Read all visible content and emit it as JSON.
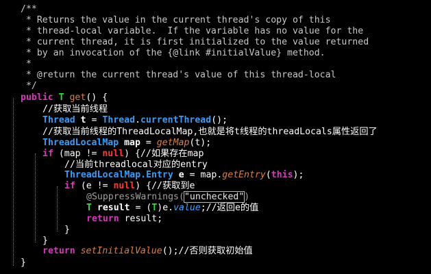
{
  "lines": [
    {
      "indent": 1,
      "tokens": [
        {
          "t": "/**",
          "k": "c"
        }
      ]
    },
    {
      "indent": 1,
      "tokens": [
        {
          "t": " * Returns the value in the current thread's copy of this",
          "k": "c"
        }
      ]
    },
    {
      "indent": 1,
      "tokens": [
        {
          "t": " * thread-local variable.  If the variable has no value for the",
          "k": "c"
        }
      ]
    },
    {
      "indent": 1,
      "tokens": [
        {
          "t": " * current thread, it is first initialized to the value returned",
          "k": "c"
        }
      ]
    },
    {
      "indent": 1,
      "tokens": [
        {
          "t": " * by an invocation of the {@link #initialValue} method.",
          "k": "c"
        }
      ]
    },
    {
      "indent": 1,
      "tokens": [
        {
          "t": " *",
          "k": "c"
        }
      ]
    },
    {
      "indent": 1,
      "tokens": [
        {
          "t": " * @return the current thread's value of this thread-local",
          "k": "c"
        }
      ]
    },
    {
      "indent": 1,
      "tokens": [
        {
          "t": " */",
          "k": "c"
        }
      ]
    },
    {
      "indent": 0,
      "tokens": [
        {
          "t": "public",
          "k": "kw"
        },
        {
          "t": " ",
          "k": "op"
        },
        {
          "t": "T",
          "k": "tp"
        },
        {
          "t": " get",
          "k": "fn"
        },
        {
          "t": "() {",
          "k": "op"
        }
      ]
    },
    {
      "indent": 2,
      "tokens": [
        {
          "t": "//获取当前线程",
          "k": "cm"
        }
      ]
    },
    {
      "indent": 2,
      "tokens": [
        {
          "t": "Thread",
          "k": "ty"
        },
        {
          "t": " ",
          "k": "op"
        },
        {
          "t": "t",
          "k": "var"
        },
        {
          "t": " = ",
          "k": "op"
        },
        {
          "t": "Thread",
          "k": "ty"
        },
        {
          "t": ".",
          "k": "op"
        },
        {
          "t": "currentThread",
          "k": "ty"
        },
        {
          "t": "();",
          "k": "op"
        }
      ]
    },
    {
      "indent": 2,
      "tokens": [
        {
          "t": "//获取当前线程的ThreadLocalMap,也就是将t线程的threadLocals属性返回了",
          "k": "cm"
        }
      ]
    },
    {
      "indent": 2,
      "tokens": [
        {
          "t": "ThreadLocalMap",
          "k": "ty"
        },
        {
          "t": " ",
          "k": "op"
        },
        {
          "t": "map",
          "k": "var"
        },
        {
          "t": " = ",
          "k": "op"
        },
        {
          "t": "getMap",
          "k": "st"
        },
        {
          "t": "(t);",
          "k": "op"
        }
      ]
    },
    {
      "indent": 2,
      "tokens": [
        {
          "t": "if",
          "k": "kw"
        },
        {
          "t": " (map != ",
          "k": "op"
        },
        {
          "t": "null",
          "k": "nul"
        },
        {
          "t": ") {",
          "k": "op"
        },
        {
          "t": "//如果存在map",
          "k": "cm"
        }
      ]
    },
    {
      "indent": 4,
      "tokens": [
        {
          "t": "//当前threadlocal对应的entry",
          "k": "cm"
        }
      ]
    },
    {
      "indent": 4,
      "tokens": [
        {
          "t": "ThreadLocalMap.Entry",
          "k": "ty"
        },
        {
          "t": " ",
          "k": "op"
        },
        {
          "t": "e",
          "k": "var"
        },
        {
          "t": " = map.",
          "k": "op"
        },
        {
          "t": "getEntry",
          "k": "st"
        },
        {
          "t": "(",
          "k": "op"
        },
        {
          "t": "this",
          "k": "kw"
        },
        {
          "t": ");",
          "k": "op"
        }
      ]
    },
    {
      "indent": 4,
      "tokens": [
        {
          "t": "if",
          "k": "kw"
        },
        {
          "t": " (e != ",
          "k": "op"
        },
        {
          "t": "null",
          "k": "nul"
        },
        {
          "t": ") {",
          "k": "op"
        },
        {
          "t": "//获取到e",
          "k": "cm"
        }
      ]
    },
    {
      "indent": 6,
      "tokens": [
        {
          "t": "@SuppressWarnings",
          "k": "ann"
        },
        {
          "t": "(",
          "k": "ann"
        },
        {
          "t": "\"unchecked\"",
          "k": "str"
        },
        {
          "t": ")",
          "k": "ann"
        }
      ]
    },
    {
      "indent": 6,
      "tokens": [
        {
          "t": "T",
          "k": "tp"
        },
        {
          "t": " ",
          "k": "op"
        },
        {
          "t": "result",
          "k": "var"
        },
        {
          "t": " = (",
          "k": "op"
        },
        {
          "t": "T",
          "k": "tp"
        },
        {
          "t": ")e.",
          "k": "op"
        },
        {
          "t": "value",
          "k": "fld"
        },
        {
          "t": ";",
          "k": "op"
        },
        {
          "t": "//返回e的值",
          "k": "cm"
        }
      ]
    },
    {
      "indent": 6,
      "tokens": [
        {
          "t": "return",
          "k": "kw"
        },
        {
          "t": " result;",
          "k": "op"
        }
      ]
    },
    {
      "indent": 4,
      "tokens": [
        {
          "t": "}",
          "k": "op"
        }
      ]
    },
    {
      "indent": 2,
      "tokens": [
        {
          "t": "}",
          "k": "op"
        }
      ]
    },
    {
      "indent": 2,
      "tokens": [
        {
          "t": "return",
          "k": "kw"
        },
        {
          "t": " ",
          "k": "op"
        },
        {
          "t": "setInitialValue",
          "k": "st"
        },
        {
          "t": "();",
          "k": "op"
        },
        {
          "t": "//否则获取初始值",
          "k": "cm"
        }
      ]
    },
    {
      "indent": 0,
      "tokens": [
        {
          "t": "}",
          "k": "op"
        }
      ]
    }
  ]
}
